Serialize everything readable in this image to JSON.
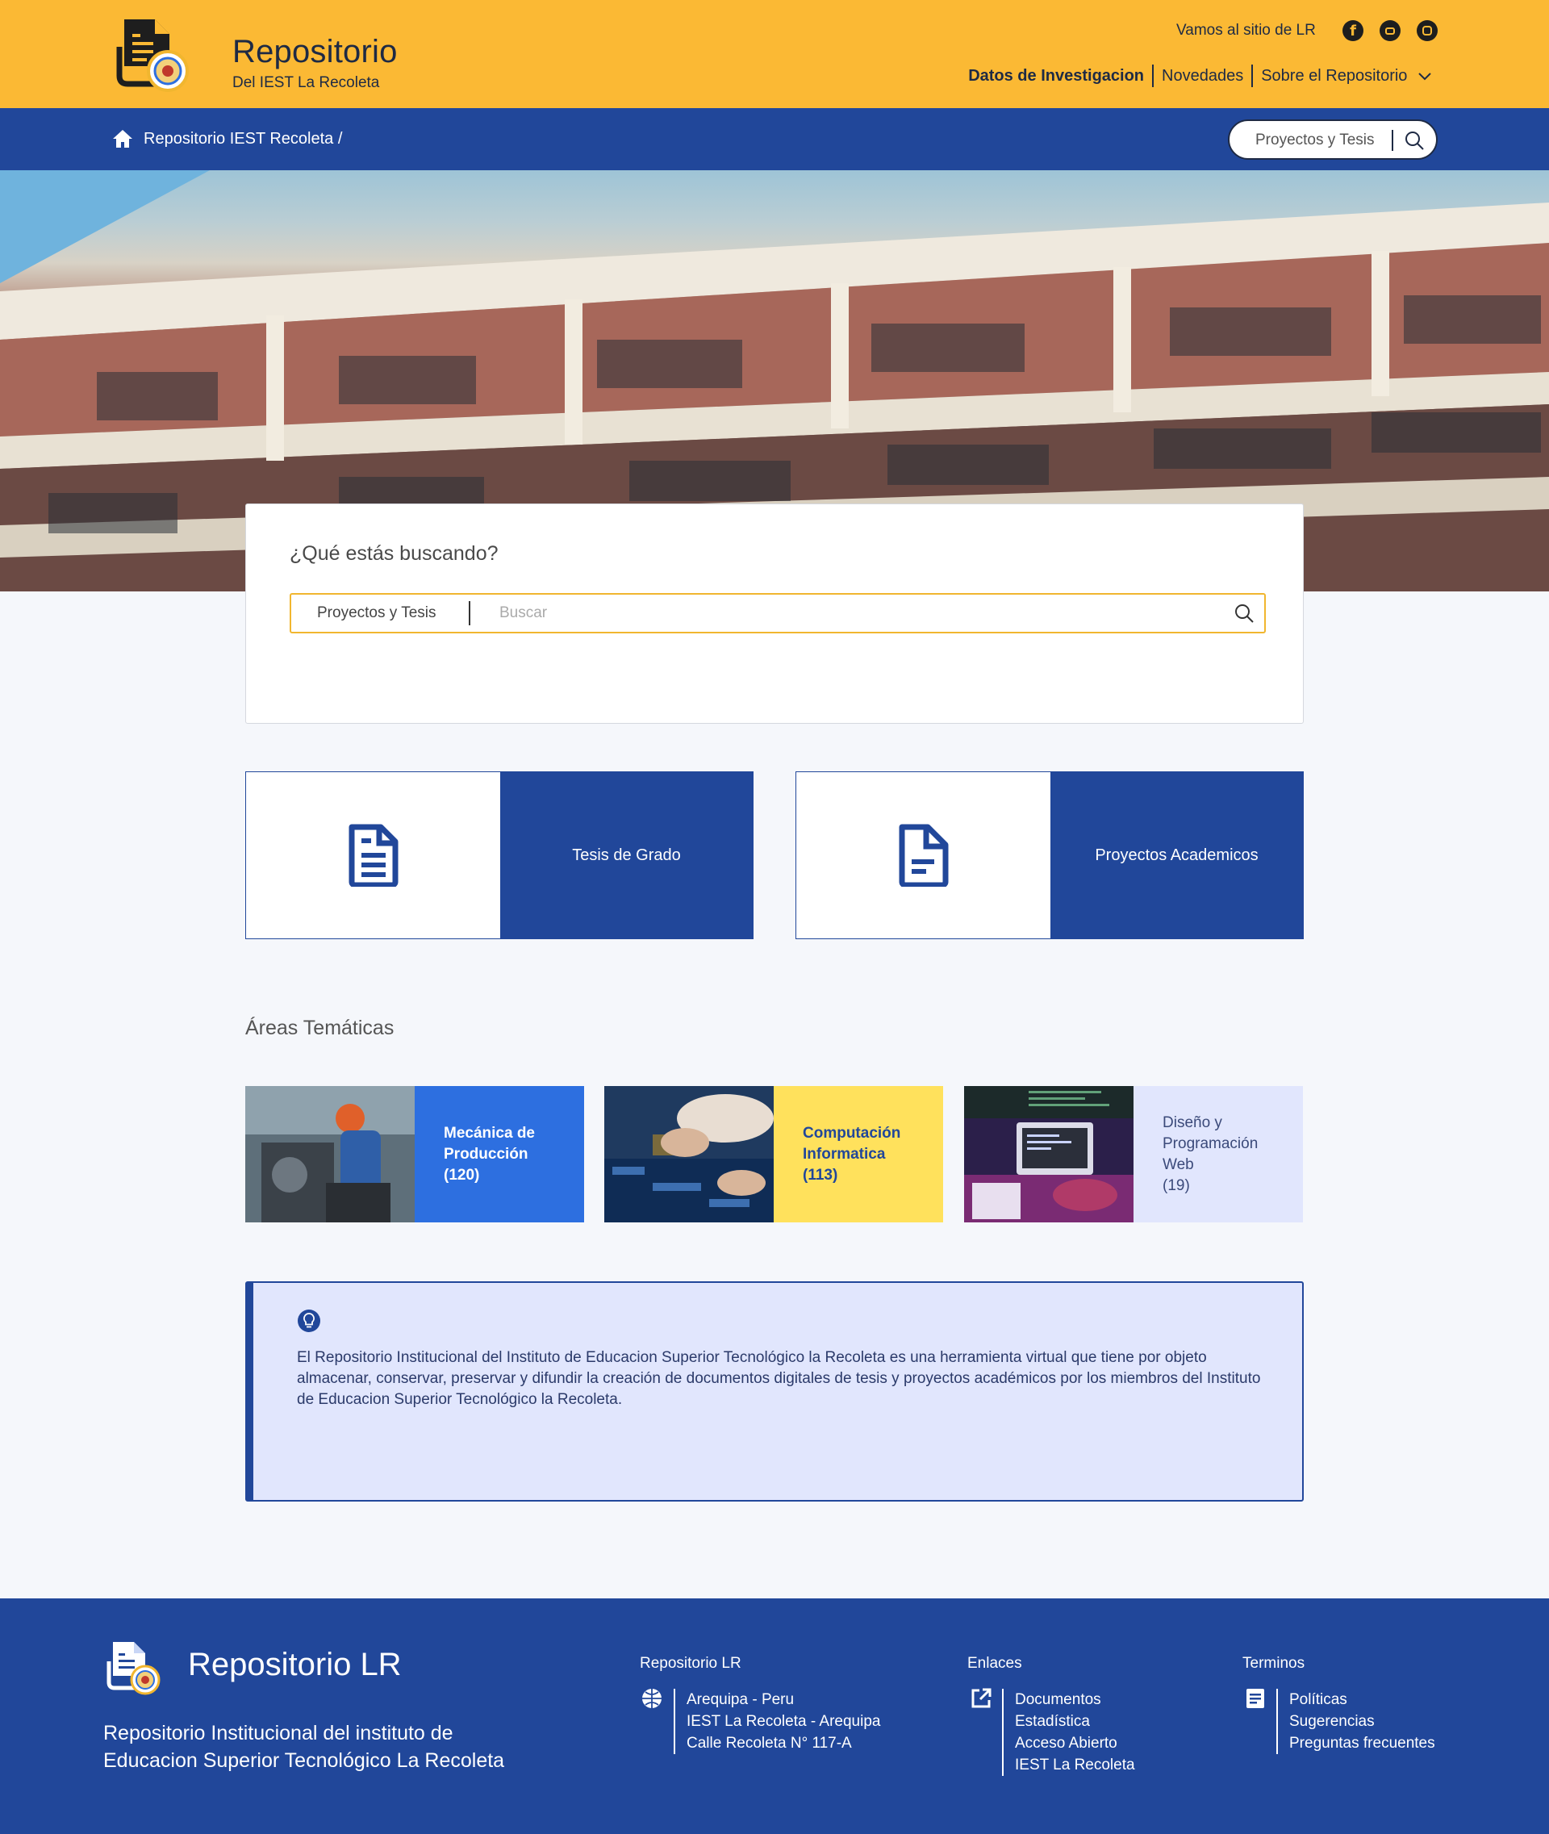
{
  "header": {
    "brand_title": "Repositorio",
    "brand_subtitle": "Del IEST La Recoleta",
    "visit_link": "Vamos al sitio de LR",
    "social": [
      "facebook-icon",
      "youtube-icon",
      "instagram-icon"
    ],
    "nav": {
      "research": "Datos de Investigacion",
      "news": "Novedades",
      "about": "Sobre el Repositorio"
    }
  },
  "breadcrumb": {
    "home_label": "Repositorio IEST Recoleta /",
    "search_category": "Proyectos y Tesis"
  },
  "search": {
    "heading": "¿Qué estás buscando?",
    "category": "Proyectos y Tesis",
    "placeholder": "Buscar"
  },
  "categories": [
    {
      "label": "Tesis de Grado",
      "icon": "document-lines-icon"
    },
    {
      "label": "Proyectos Academicos",
      "icon": "document-icon"
    }
  ],
  "areas": {
    "title": "Áreas Temáticas",
    "items": [
      {
        "line1": "Mecánica de",
        "line2": "Producción",
        "line3": "(120)",
        "line4": "",
        "color": "#2d6fe0",
        "text_color": "#ffffff"
      },
      {
        "line1": "Computación",
        "line2": "Informatica",
        "line3": "(113)",
        "line4": "",
        "color": "#ffe15c",
        "text_color": "#21479a"
      },
      {
        "line1": "Diseño y",
        "line2": "Programación",
        "line3": "Web",
        "line4": "(19)",
        "color": "#e1e6fd",
        "text_color": "#3b4a7a"
      }
    ]
  },
  "info": {
    "text": "El Repositorio Institucional del Instituto de Educacion Superior Tecnológico la Recoleta es una herramienta virtual que tiene por objeto almacenar, conservar, preservar y difundir la creación de documentos digitales de tesis y proyectos académicos por los miembros  del Instituto de Educacion Superior  Tecnológico la Recoleta."
  },
  "footer": {
    "title": "Repositorio LR",
    "description": "Repositorio Institucional del instituto de Educacion Superior Tecnológico La Recoleta",
    "col1": {
      "title": "Repositorio LR",
      "lines": [
        "Arequipa - Peru",
        "IEST La Recoleta - Arequipa",
        "Calle Recoleta N° 117-A"
      ]
    },
    "col2": {
      "title": "Enlaces",
      "lines": [
        "Documentos",
        "Estadística",
        "Acceso Abierto",
        "IEST La Recoleta"
      ]
    },
    "col3": {
      "title": "Terminos",
      "lines": [
        "Políticas",
        "Sugerencias",
        "Preguntas frecuentes"
      ]
    }
  },
  "colors": {
    "header_yellow": "#fbb934",
    "brand_blue": "#21479a",
    "accent_yellow": "#f1b62f"
  }
}
